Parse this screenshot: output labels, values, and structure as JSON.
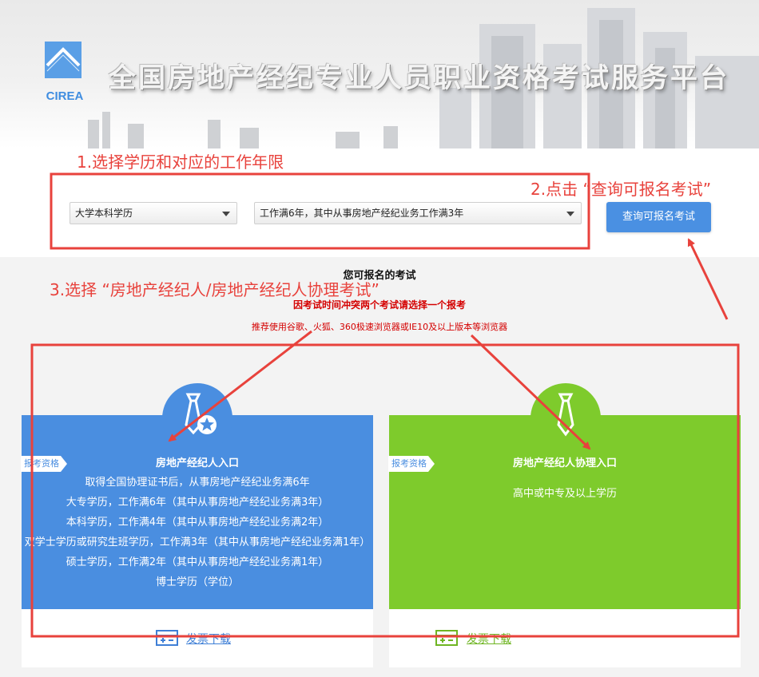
{
  "header": {
    "logo_text": "CIREA",
    "site_title": "全国房地产经纪专业人员职业资格考试服务平台"
  },
  "selection": {
    "education_value": "大学本科学历",
    "experience_value": "工作满6年，其中从事房地产经纪业务工作满3年",
    "query_button": "查询可报名考试"
  },
  "notices": {
    "available_title": "您可报名的考试",
    "conflict_note": "因考试时间冲突两个考试请选择一个报考",
    "browser_note": "推荐使用谷歌、火狐、360极速浏览器或IE10及以上版本等浏览器"
  },
  "cards": {
    "agent": {
      "tag": "报考资格",
      "name": "房地产经纪人入口",
      "requirements": [
        "取得全国协理证书后，从事房地产经纪业务满6年",
        "大专学历，工作满6年（其中从事房地产经纪业务满3年）",
        "本科学历，工作满4年（其中从事房地产经纪业务满2年）",
        "双学士学历或研究生班学历，工作满3年（其中从事房地产经纪业务满1年）",
        "硕士学历，工作满2年（其中从事房地产经纪业务满1年）",
        "博士学历（学位）"
      ],
      "download": "发票下载"
    },
    "assistant": {
      "tag": "报考资格",
      "name": "房地产经纪人协理入口",
      "requirement": "高中或中专及以上学历",
      "download": "发票下载"
    }
  },
  "annotations": {
    "step1": "1.选择学历和对应的工作年限",
    "step2": "2.点击 “查询可报名考试”",
    "step3": "3.选择 “房地产经纪人/房地产经纪人协理考试”"
  },
  "colors": {
    "blue": "#4a8ee0",
    "green": "#7ecb2c",
    "annotation_red": "#e8423c",
    "notice_red": "#d40000"
  }
}
